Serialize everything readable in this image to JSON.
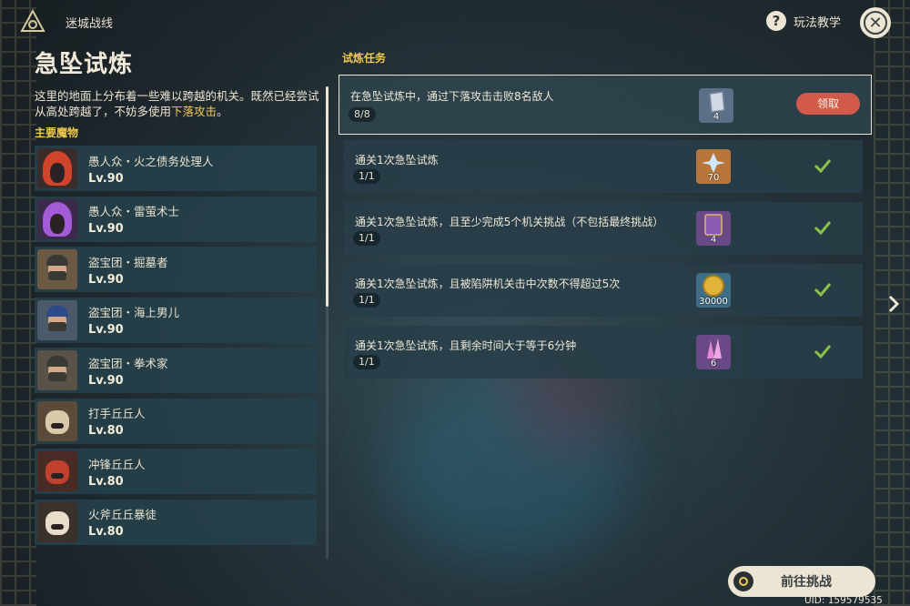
{
  "header": {
    "app_title": "迷城战线",
    "help_label": "玩法教学"
  },
  "left": {
    "page_title": "急坠试炼",
    "description_pre": "这里的地面上分布着一些难以跨越的机关。既然已经尝试从高处跨越了，不妨多使用",
    "description_highlight": "下落攻击",
    "description_post": "。",
    "section_label": "主要魔物",
    "monsters": [
      {
        "name": "愚人众・火之债务处理人",
        "level": "Lv.90",
        "colors": {
          "bg": "#3a2c2a",
          "accent": "#d0442b"
        }
      },
      {
        "name": "愚人众・雷萤术士",
        "level": "Lv.90",
        "colors": {
          "bg": "#3c2a4a",
          "accent": "#a35bd6"
        }
      },
      {
        "name": "盗宝团・掘墓者",
        "level": "Lv.90",
        "colors": {
          "bg": "#6a5a44",
          "accent": "#3a3a34"
        }
      },
      {
        "name": "盗宝团・海上男儿",
        "level": "Lv.90",
        "colors": {
          "bg": "#4a5a6a",
          "accent": "#2a4a8a"
        }
      },
      {
        "name": "盗宝团・拳术家",
        "level": "Lv.90",
        "colors": {
          "bg": "#5a5248",
          "accent": "#3a3a34"
        }
      },
      {
        "name": "打手丘丘人",
        "level": "Lv.80",
        "colors": {
          "bg": "#5a4a3a",
          "accent": "#d8c9a8"
        }
      },
      {
        "name": "冲锋丘丘人",
        "level": "Lv.80",
        "colors": {
          "bg": "#4a2a24",
          "accent": "#c4402e"
        }
      },
      {
        "name": "火斧丘丘暴徒",
        "level": "Lv.80",
        "colors": {
          "bg": "#3a302c",
          "accent": "#e8ddc8"
        }
      }
    ]
  },
  "tasks": {
    "header": "试炼任务",
    "claim_label": "领取",
    "items": [
      {
        "title": "在急坠试炼中，通过下落攻击击败8名敌人",
        "progress": "8/8",
        "reward_count": "4",
        "reward_icon": "artifact-fragment-icon",
        "reward_color": "#5b6f86",
        "status": "claimable"
      },
      {
        "title": "通关1次急坠试炼",
        "progress": "1/1",
        "reward_count": "70",
        "reward_icon": "primogem-icon",
        "reward_color": "#b8773a",
        "status": "claimed"
      },
      {
        "title": "通关1次急坠试炼，且至少完成5个机关挑战（不包括最终挑战）",
        "progress": "1/1",
        "reward_count": "4",
        "reward_icon": "exp-book-icon",
        "reward_color": "#6a4a86",
        "status": "claimed"
      },
      {
        "title": "通关1次急坠试炼，且被陷阱机关击中次数不得超过5次",
        "progress": "1/1",
        "reward_count": "30000",
        "reward_icon": "mora-icon",
        "reward_color": "#3e6e86",
        "status": "claimed"
      },
      {
        "title": "通关1次急坠试炼，且剩余时间大于等于6分钟",
        "progress": "1/1",
        "reward_count": "6",
        "reward_icon": "crystal-ore-icon",
        "reward_color": "#6a4a86",
        "status": "claimed"
      }
    ]
  },
  "footer": {
    "challenge_label": "前往挑战",
    "uid": "UID: 159579535"
  },
  "colors": {
    "accent_gold": "#f2c94c",
    "claim_red": "#d25a4b",
    "check_green": "#8bc34a"
  }
}
